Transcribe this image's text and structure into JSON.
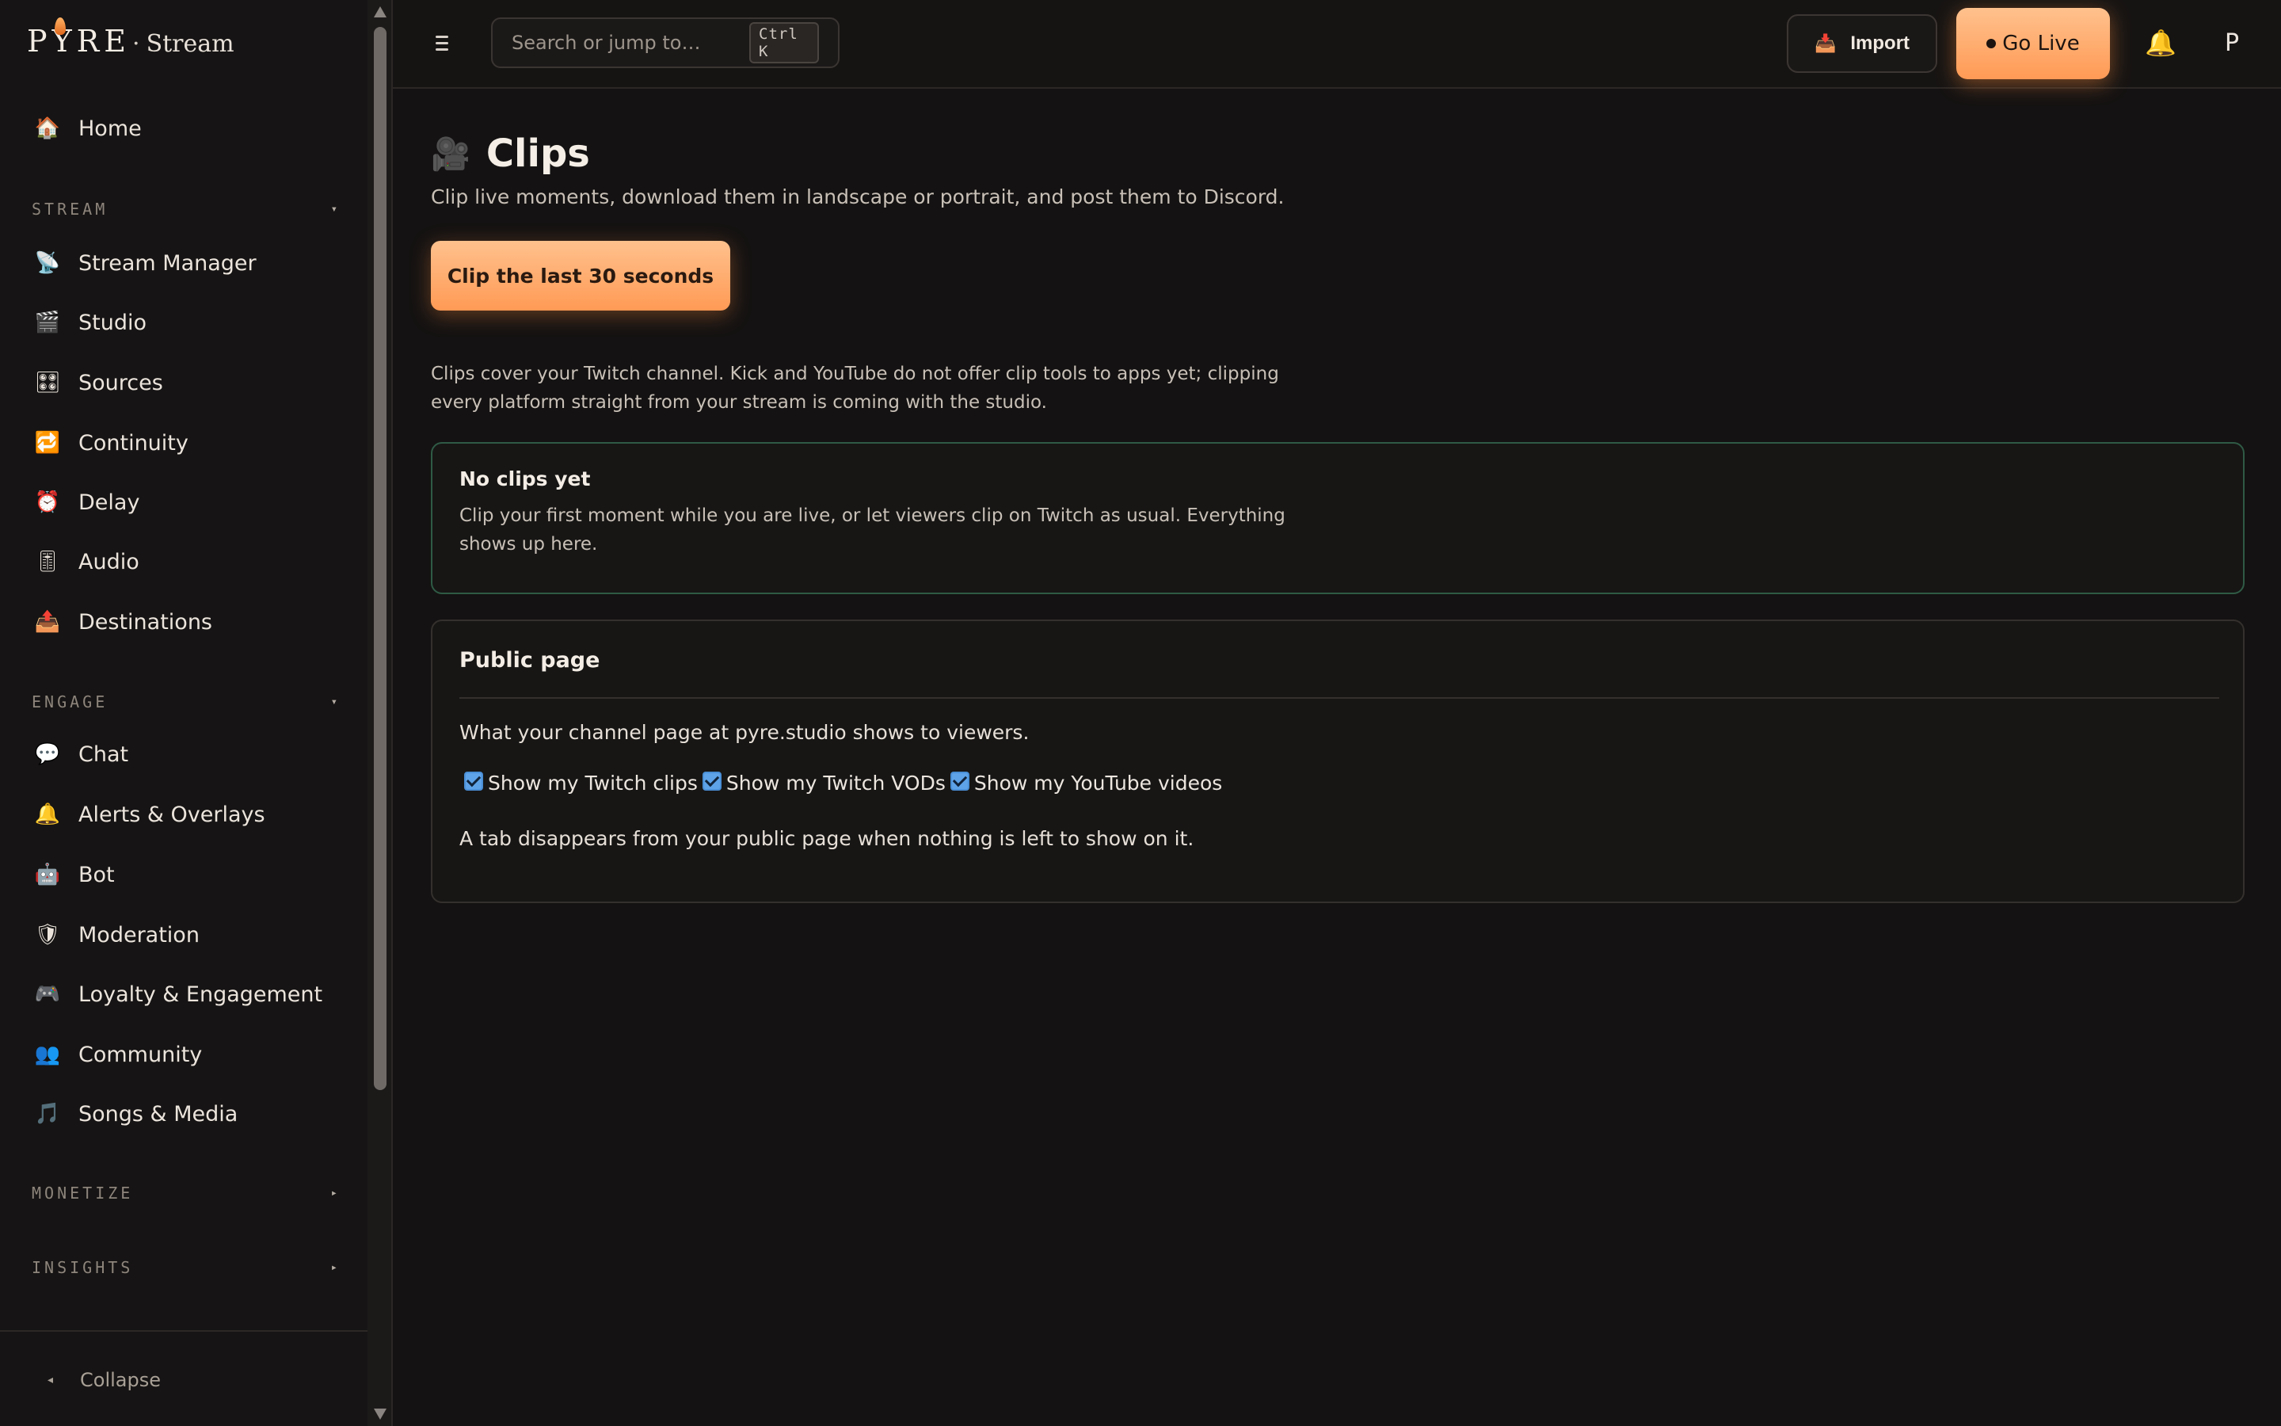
{
  "app": {
    "brand": "PYRE",
    "brand_separator": "·",
    "brand_product": "Stream"
  },
  "topbar": {
    "menu_icon": "hamburger-icon",
    "search_placeholder": "Search or jump to…",
    "search_shortcut": "Ctrl K",
    "import_label": "Import",
    "import_icon": "inbox-tray-icon",
    "golive_label": "Go Live",
    "notifications_icon": "bell-icon",
    "avatar_initial": "P"
  },
  "sidebar": {
    "home": {
      "label": "Home",
      "icon": "house-icon",
      "glyph": "🏠"
    },
    "sections": [
      {
        "label": "STREAM",
        "expanded": true,
        "caret": "▾",
        "items": [
          {
            "label": "Stream Manager",
            "icon": "satellite-dish-icon",
            "glyph": "📡"
          },
          {
            "label": "Studio",
            "icon": "clapper-board-icon",
            "glyph": "🎬"
          },
          {
            "label": "Sources",
            "icon": "control-knobs-icon",
            "glyph": "🎛"
          },
          {
            "label": "Continuity",
            "icon": "repeat-icon",
            "glyph": "🔁"
          },
          {
            "label": "Delay",
            "icon": "alarm-clock-icon",
            "glyph": "⏰"
          },
          {
            "label": "Audio",
            "icon": "audio-meter-icon",
            "glyph": "🎚"
          },
          {
            "label": "Destinations",
            "icon": "outbox-tray-icon",
            "glyph": "📤"
          }
        ]
      },
      {
        "label": "ENGAGE",
        "expanded": true,
        "caret": "▾",
        "items": [
          {
            "label": "Chat",
            "icon": "speech-bubble-icon",
            "glyph": "💬"
          },
          {
            "label": "Alerts & Overlays",
            "icon": "bell-icon",
            "glyph": "🔔"
          },
          {
            "label": "Bot",
            "icon": "robot-icon",
            "glyph": "🤖"
          },
          {
            "label": "Moderation",
            "icon": "shield-icon",
            "glyph": "🛡"
          },
          {
            "label": "Loyalty & Engagement",
            "icon": "game-controller-icon",
            "glyph": "🎮"
          },
          {
            "label": "Community",
            "icon": "people-icon",
            "glyph": "👥"
          },
          {
            "label": "Songs & Media",
            "icon": "music-note-icon",
            "glyph": "🎵"
          }
        ]
      },
      {
        "label": "MONETIZE",
        "expanded": false,
        "caret": "▸",
        "items": []
      },
      {
        "label": "INSIGHTS",
        "expanded": false,
        "caret": "▸",
        "items": []
      }
    ],
    "collapse_caret": "◂",
    "collapse_label": "Collapse"
  },
  "main": {
    "title_icon": "movie-camera-icon",
    "title_glyph": "🎥",
    "title": "Clips",
    "subtitle": "Clip live moments, download them in landscape or portrait, and post them to Discord.",
    "clip_button_label": "Clip the last 30 seconds",
    "coverage_note": "Clips cover your Twitch channel. Kick and YouTube do not offer clip tools to apps yet; clipping every platform straight from your stream is coming with the studio.",
    "empty_state": {
      "title": "No clips yet",
      "text": "Clip your first moment while you are live, or let viewers clip on Twitch as usual. Everything shows up here."
    },
    "public_page": {
      "title": "Public page",
      "description": "What your channel page at pyre.studio shows to viewers.",
      "options": [
        {
          "label": "Show my Twitch clips",
          "checked": true
        },
        {
          "label": "Show my Twitch VODs",
          "checked": true
        },
        {
          "label": "Show my YouTube videos",
          "checked": true
        }
      ],
      "footnote": "A tab disappears from your public page when nothing is left to show on it."
    }
  },
  "colors": {
    "background": "#141212",
    "accent_gradient_top": "#ffc18d",
    "accent_gradient_bottom": "#ff9a55",
    "empty_card_border": "#2f5a45",
    "checkbox": "#5ea3e8"
  }
}
